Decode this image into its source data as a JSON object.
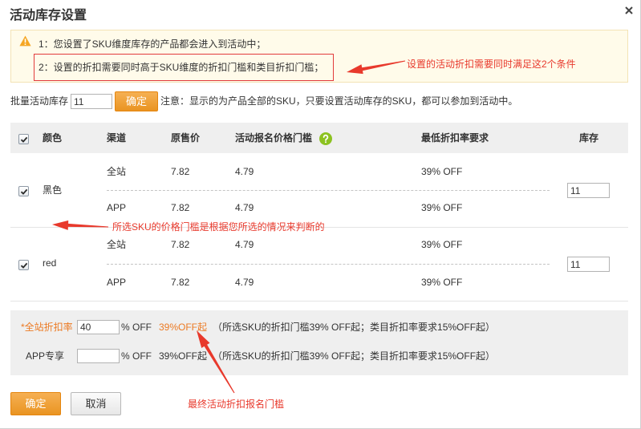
{
  "dialog": {
    "title": "活动库存设置"
  },
  "notice": {
    "line1": "1：您设置了SKU维度库存的产品都会进入到活动中；",
    "line2": "2：设置的折扣需要同时高于SKU维度的折扣门槛和类目折扣门槛；"
  },
  "batch": {
    "label": "批量活动库存",
    "value": "11",
    "confirm_label": "确定",
    "note": "注意：显示的为产品全部的SKU，只要设置活动库存的SKU，都可以参加到活动中。"
  },
  "table": {
    "select_all_checked": true,
    "headers": {
      "color": "颜色",
      "channel": "渠道",
      "original_price": "原售价",
      "price_threshold": "活动报名价格门槛",
      "min_discount": "最低折扣率要求",
      "stock": "库存"
    },
    "rows": [
      {
        "checked": true,
        "color": "黑色",
        "stock": "11",
        "channels": [
          {
            "channel": "全站",
            "original_price": "7.82",
            "price_threshold": "4.79",
            "min_discount": "39% OFF"
          },
          {
            "channel": "APP",
            "original_price": "7.82",
            "price_threshold": "4.79",
            "min_discount": "39% OFF"
          }
        ]
      },
      {
        "checked": true,
        "color": "red",
        "stock": "11",
        "channels": [
          {
            "channel": "全站",
            "original_price": "7.82",
            "price_threshold": "4.79",
            "min_discount": "39% OFF"
          },
          {
            "channel": "APP",
            "original_price": "7.82",
            "price_threshold": "4.79",
            "min_discount": "39% OFF"
          }
        ]
      }
    ]
  },
  "discount": {
    "site": {
      "label": "*全站折扣率",
      "value": "40",
      "unit": "% OFF",
      "threshold": "39%OFF起",
      "note": "（所选SKU的折扣门槛39% OFF起；类目折扣率要求15%OFF起）"
    },
    "app": {
      "label": "APP专享",
      "value": "",
      "unit": "% OFF",
      "threshold": "39%OFF起",
      "note": "（所选SKU的折扣门槛39% OFF起；类目折扣率要求15%OFF起）"
    }
  },
  "footer": {
    "confirm_label": "确定",
    "cancel_label": "取消"
  },
  "annotations": {
    "conditions": "设置的活动折扣需要同时满足这2个条件",
    "sku_threshold": "所选SKU的价格门槛是根据您所选的情况来判断的",
    "final_threshold": "最终活动折扣报名门槛"
  },
  "icons": {
    "close": "close-icon",
    "warning": "warning-icon",
    "help": "help-icon",
    "checkbox": "checkmark-icon",
    "arrow": "annotation-arrow"
  },
  "colors": {
    "accent": "#f39a23",
    "annotation": "#e8392c",
    "highlight": "#ec7a23",
    "help": "#8cc220",
    "warning": "#f5a623",
    "frame": "#e23b3b"
  }
}
